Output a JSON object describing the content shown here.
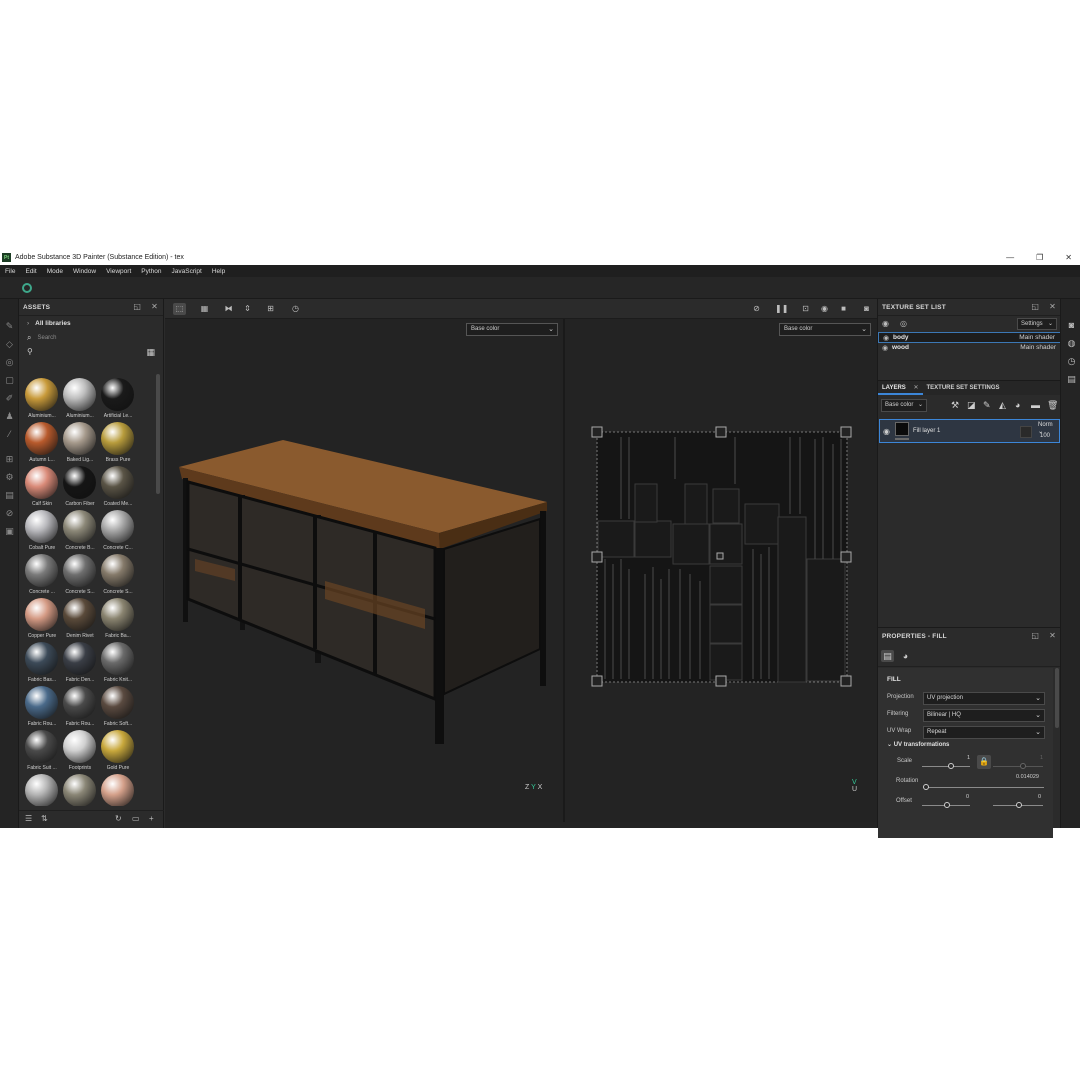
{
  "window": {
    "logo": "Pt",
    "title": "Adobe Substance 3D Painter (Substance Edition) - tex",
    "minimize": "—",
    "restore": "❐",
    "close": "✕"
  },
  "menu": [
    "File",
    "Edit",
    "Mode",
    "Window",
    "Viewport",
    "Python",
    "JavaScript",
    "Help"
  ],
  "assets": {
    "title": "ASSETS",
    "libraries": "All libraries",
    "search_placeholder": "Search",
    "items": [
      {
        "label": "Aluminium...",
        "color": "#c89a3a"
      },
      {
        "label": "Aluminium...",
        "color": "#bdbdbd"
      },
      {
        "label": "Artificial Le...",
        "color": "#1a1a1a"
      },
      {
        "label": "Autumn L...",
        "color": "#b85a2c"
      },
      {
        "label": "Baked Lig...",
        "color": "#a69a8c"
      },
      {
        "label": "Brass Pure",
        "color": "#b89c3c"
      },
      {
        "label": "Calf Skin",
        "color": "#d98a78"
      },
      {
        "label": "Carbon Fiber",
        "color": "#151515"
      },
      {
        "label": "Coated Me...",
        "color": "#5a5446"
      },
      {
        "label": "Cobalt Pure",
        "color": "#b8b8bc"
      },
      {
        "label": "Concrete B...",
        "color": "#8c8878"
      },
      {
        "label": "Concrete C...",
        "color": "#a8a8a8"
      },
      {
        "label": "Concrete ...",
        "color": "#7a7a7a"
      },
      {
        "label": "Concrete S...",
        "color": "#6e6e6e"
      },
      {
        "label": "Concrete S...",
        "color": "#857a6a"
      },
      {
        "label": "Copper Pure",
        "color": "#d49a84"
      },
      {
        "label": "Denim Rivet",
        "color": "#5a4a3a"
      },
      {
        "label": "Fabric Ba...",
        "color": "#8a8470"
      },
      {
        "label": "Fabric Bas...",
        "color": "#3c4a58"
      },
      {
        "label": "Fabric Den...",
        "color": "#3a3e46"
      },
      {
        "label": "Fabric Knit...",
        "color": "#6a6a6a"
      },
      {
        "label": "Fabric Rou...",
        "color": "#4a6a8a"
      },
      {
        "label": "Fabric Rou...",
        "color": "#4a4a4a"
      },
      {
        "label": "Fabric Soft...",
        "color": "#5a4a40"
      },
      {
        "label": "Fabric Suit ...",
        "color": "#4a4a4a"
      },
      {
        "label": "Footprints",
        "color": "#d0d0d0"
      },
      {
        "label": "Gold Pure",
        "color": "#c8a83c"
      },
      {
        "label": "",
        "color": "#b4b4b4"
      },
      {
        "label": "",
        "color": "#8a8676"
      },
      {
        "label": "",
        "color": "#d4a08a"
      }
    ]
  },
  "viewport": {
    "left_channel": "Base color",
    "right_channel": "Base color",
    "gizmo_z": "Z",
    "gizmo_x": "X",
    "gizmo_y": "Y",
    "uv_u": "U",
    "uv_v": "V"
  },
  "texture_set_list": {
    "title": "TEXTURE SET LIST",
    "settings": "Settings",
    "rows": [
      {
        "name": "body",
        "shader": "Main shader"
      },
      {
        "name": "wood",
        "shader": "Main shader"
      }
    ]
  },
  "layers": {
    "tab_layers": "LAYERS",
    "tab_tss": "TEXTURE SET SETTINGS",
    "channel": "Base color",
    "layer_name": "Fill layer 1",
    "blend": "Norm",
    "opacity": "100"
  },
  "properties": {
    "title": "PROPERTIES - FILL",
    "section": "FILL",
    "projection_label": "Projection",
    "projection_value": "UV projection",
    "filtering_label": "Filtering",
    "filtering_value": "Bilinear | HQ",
    "uvwrap_label": "UV Wrap",
    "uvwrap_value": "Repeat",
    "uv_transform": "UV transformations",
    "scale_label": "Scale",
    "scale_value": "1",
    "scale_value2": "1",
    "rotation_label": "Rotation",
    "rotation_value": "0.014029",
    "offset_label": "Offset",
    "offset_x": "0",
    "offset_y": "0"
  }
}
